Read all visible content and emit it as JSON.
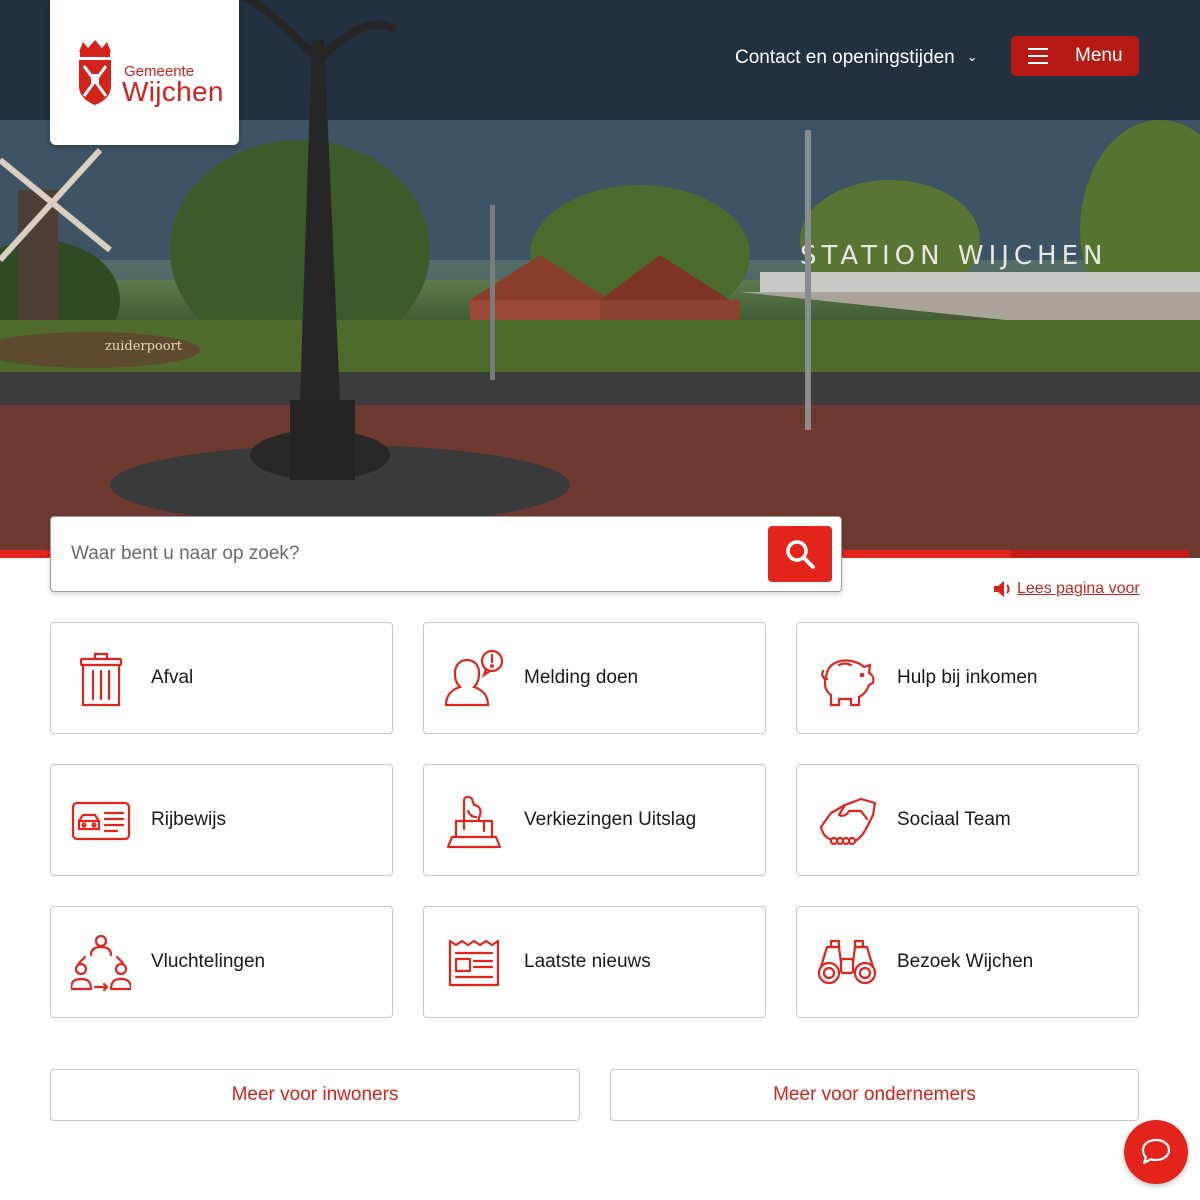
{
  "logo": {
    "top_line": "Gemeente",
    "name": "Wijchen"
  },
  "header": {
    "contact_label": "Contact en openingstijden",
    "menu_label": "Menu"
  },
  "hero": {
    "sign_text": "STATION WIJCHEN",
    "monument_text": "zuiderpoort"
  },
  "search": {
    "placeholder": "Waar bent u naar op zoek?"
  },
  "read_aloud": {
    "label": "Lees pagina voor"
  },
  "tiles": [
    {
      "label": "Afval",
      "icon": "trash-bin-icon"
    },
    {
      "label": "Melding doen",
      "icon": "person-alert-icon"
    },
    {
      "label": "Hulp bij inkomen",
      "icon": "piggy-bank-icon"
    },
    {
      "label": "Rijbewijs",
      "icon": "drivers-license-icon"
    },
    {
      "label": "Verkiezingen Uitslag",
      "icon": "ballot-box-icon"
    },
    {
      "label": "Sociaal Team",
      "icon": "handshake-icon"
    },
    {
      "label": "Vluchtelingen",
      "icon": "people-cycle-icon"
    },
    {
      "label": "Laatste nieuws",
      "icon": "newspaper-icon"
    },
    {
      "label": "Bezoek Wijchen",
      "icon": "binoculars-icon"
    }
  ],
  "more": {
    "residents_label": "Meer voor inwoners",
    "business_label": "Meer voor ondernemers"
  },
  "colors": {
    "brand_red": "#e3241b",
    "dark_red": "#b51a13",
    "text": "#1a1a1a",
    "border": "#c7c7c7"
  }
}
